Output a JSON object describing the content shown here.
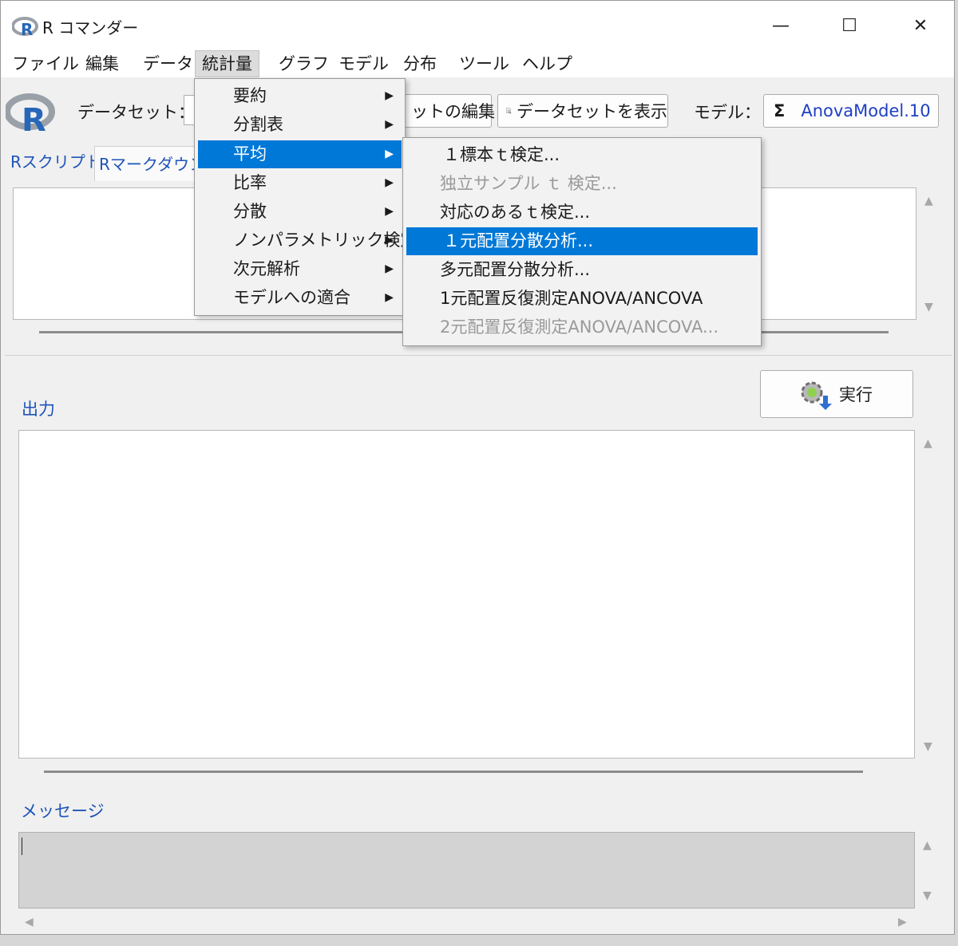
{
  "window": {
    "title": "R コマンダー",
    "controls": {
      "minimize": "—",
      "maximize": "☐",
      "close": "✕"
    }
  },
  "menubar": {
    "items": [
      {
        "label": "ファイル"
      },
      {
        "label": "編集"
      },
      {
        "label": "データ"
      },
      {
        "label": "統計量"
      },
      {
        "label": "グラフ"
      },
      {
        "label": "モデル"
      },
      {
        "label": "分布"
      },
      {
        "label": "ツール"
      },
      {
        "label": "ヘルプ"
      }
    ]
  },
  "toolbar": {
    "logo": "R",
    "dataset_label": "データセット：",
    "edit_dataset": "ットの編集",
    "view_dataset": "データセットを表示",
    "model_label": "モデル：",
    "model_sigma": "Σ",
    "model_value": "AnovaModel.10"
  },
  "tabs": {
    "script": "Rスクリプト",
    "markdown": "Rマークダウン"
  },
  "execute_button": "実行",
  "sections": {
    "output": "出力",
    "messages": "メッセージ"
  },
  "stats_menu": {
    "items": [
      {
        "label": "要約",
        "arrow": "▶"
      },
      {
        "label": "分割表",
        "arrow": "▶"
      },
      {
        "label": "平均",
        "arrow": "▶"
      },
      {
        "label": "比率",
        "arrow": "▶"
      },
      {
        "label": "分散",
        "arrow": "▶"
      },
      {
        "label": "ノンパラメトリック検定",
        "arrow": "▶"
      },
      {
        "label": "次元解析",
        "arrow": "▶"
      },
      {
        "label": "モデルへの適合",
        "arrow": "▶"
      }
    ]
  },
  "means_submenu": {
    "items": [
      {
        "label": "１標本ｔ検定..."
      },
      {
        "label": "独立サンプル ｔ 検定..."
      },
      {
        "label": "対応のあるｔ検定..."
      },
      {
        "label": "１元配置分散分析..."
      },
      {
        "label": "多元配置分散分析..."
      },
      {
        "label": "1元配置反復測定ANOVA/ANCOVA"
      },
      {
        "label": "2元配置反復測定ANOVA/ANCOVA..."
      }
    ]
  },
  "scroll": {
    "up": "▲",
    "down": "▼",
    "left": "◀",
    "right": "▶"
  }
}
